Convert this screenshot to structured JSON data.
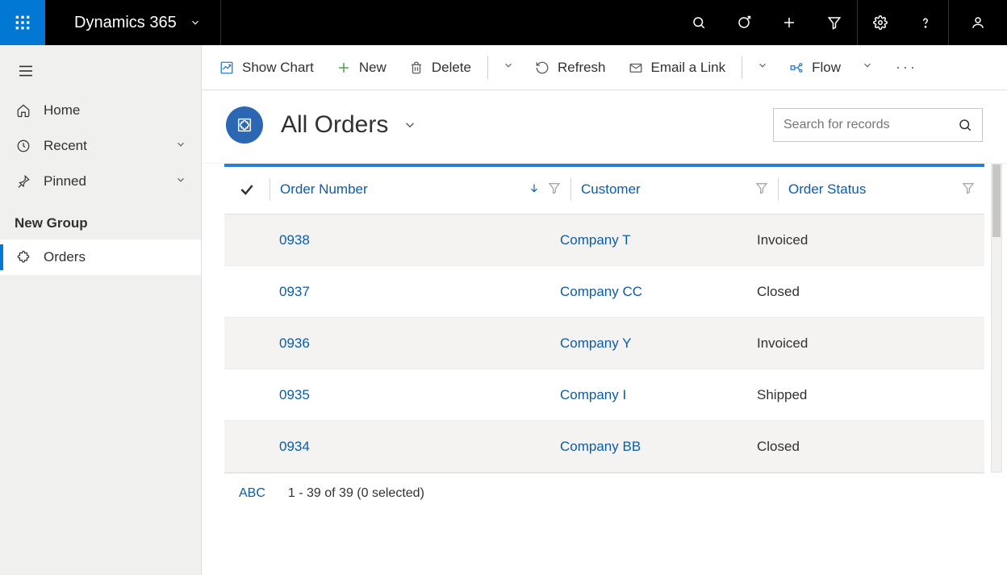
{
  "topbar": {
    "brand": "Dynamics 365"
  },
  "sidebar": {
    "home": "Home",
    "recent": "Recent",
    "pinned": "Pinned",
    "group_label": "New Group",
    "orders": "Orders"
  },
  "cmdbar": {
    "show_chart": "Show Chart",
    "new": "New",
    "delete": "Delete",
    "refresh": "Refresh",
    "email_link": "Email a Link",
    "flow": "Flow"
  },
  "page": {
    "title": "All Orders",
    "search_placeholder": "Search for records"
  },
  "grid": {
    "columns": {
      "order_number": "Order Number",
      "customer": "Customer",
      "order_status": "Order Status"
    },
    "rows": [
      {
        "order": "0938",
        "customer": "Company T",
        "status": "Invoiced"
      },
      {
        "order": "0937",
        "customer": "Company CC",
        "status": "Closed"
      },
      {
        "order": "0936",
        "customer": "Company Y",
        "status": "Invoiced"
      },
      {
        "order": "0935",
        "customer": "Company I",
        "status": "Shipped"
      },
      {
        "order": "0934",
        "customer": "Company BB",
        "status": "Closed"
      }
    ],
    "footer": {
      "abc": "ABC",
      "summary": "1 - 39 of 39 (0 selected)"
    }
  }
}
